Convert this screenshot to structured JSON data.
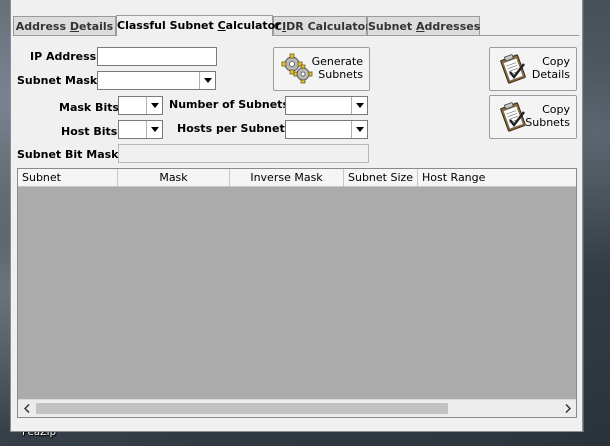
{
  "desktop": {
    "label": "PeaZip"
  },
  "tabs": [
    {
      "label_pre": "Address ",
      "label_u": "D",
      "label_post": "etails",
      "active": false
    },
    {
      "label_pre": "Classful Subnet ",
      "label_u": "C",
      "label_post": "alculator",
      "active": true
    },
    {
      "label_pre": "C",
      "label_u": "I",
      "label_post": "DR Calculator",
      "active": false
    },
    {
      "label_pre": "Subnet ",
      "label_u": "A",
      "label_post": "ddresses",
      "active": false
    }
  ],
  "form": {
    "ip_address_label": "IP Address",
    "ip_address_value": "",
    "subnet_mask_label": "Subnet Mask",
    "subnet_mask_value": "",
    "mask_bits_label": "Mask Bits",
    "mask_bits_value": "",
    "number_of_subnets_label": "Number of Subnets",
    "number_of_subnets_value": "",
    "host_bits_label": "Host Bits",
    "host_bits_value": "",
    "hosts_per_subnet_label": "Hosts per Subnet",
    "hosts_per_subnet_value": "",
    "subnet_bit_mask_label": "Subnet Bit Mask",
    "subnet_bit_mask_value": ""
  },
  "buttons": {
    "generate_line1": "Generate",
    "generate_line2": "Subnets",
    "copy_details_line1": "Copy",
    "copy_details_line2": "Details",
    "copy_subnets_line1": "Copy",
    "copy_subnets_line2": "Subnets"
  },
  "table": {
    "columns": [
      "Subnet",
      "Mask",
      "Inverse Mask",
      "Subnet Size",
      "Host Range"
    ],
    "rows": []
  },
  "icons": {
    "generate": "gears-icon",
    "copy": "clipboard-check-icon",
    "dropdown": "chevron-down-icon",
    "scroll_left": "arrow-left-icon",
    "scroll_right": "arrow-right-icon"
  }
}
